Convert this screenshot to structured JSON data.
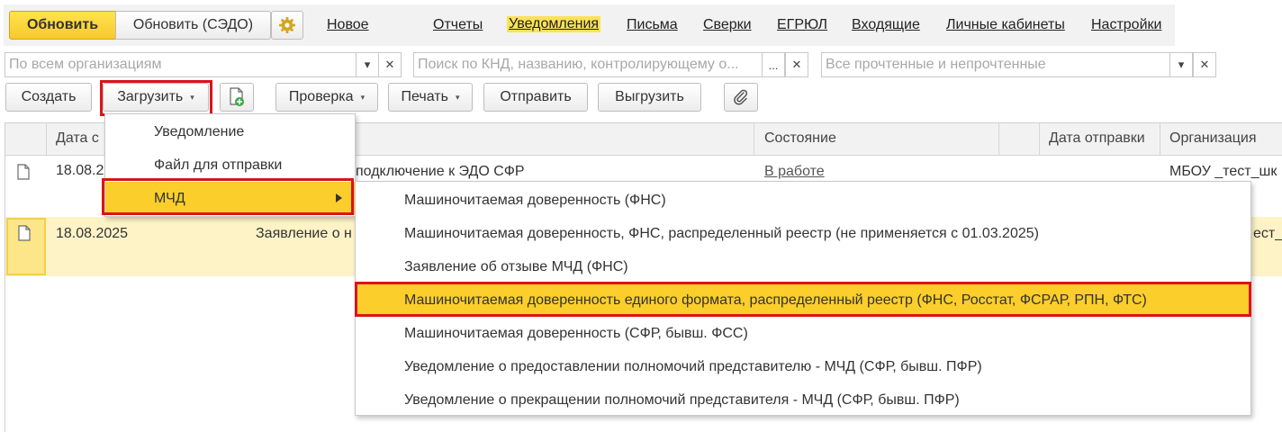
{
  "topbar": {
    "refresh_label": "Обновить",
    "refresh_sedo_label": "Обновить (СЭДО)",
    "settings_icon": "gear-icon",
    "nav": [
      {
        "label": "Новое",
        "active": false
      },
      {
        "label": "Отчеты",
        "active": false
      },
      {
        "label": "Уведомления",
        "active": true
      },
      {
        "label": "Письма",
        "active": false
      },
      {
        "label": "Сверки",
        "active": false
      },
      {
        "label": "ЕГРЮЛ",
        "active": false
      },
      {
        "label": "Входящие",
        "active": false
      },
      {
        "label": "Личные кабинеты",
        "active": false
      },
      {
        "label": "Настройки",
        "active": false
      }
    ]
  },
  "filters": {
    "org_placeholder": "По всем организациям",
    "search_placeholder": "Поиск по КНД, названию, контролирующему о...",
    "read_placeholder": "Все прочтенные и непрочтенные",
    "select_btn": "...",
    "dropdown_icon": "▾",
    "clear_icon": "✕"
  },
  "toolbar": {
    "create_label": "Создать",
    "upload_label": "Загрузить",
    "check_label": "Проверка",
    "print_label": "Печать",
    "send_label": "Отправить",
    "export_label": "Выгрузить",
    "caret": "▾"
  },
  "table": {
    "columns": {
      "date": "Дата с",
      "state": "Состояние",
      "sent_date": "Дата отправки",
      "org": "Организация"
    },
    "rows": [
      {
        "date": "18.08.2",
        "name": "подключение к ЭДО СФР",
        "state": "В работе",
        "org": "МБОУ _тест_шк"
      },
      {
        "date": "18.08.2025",
        "name": "Заявление о н",
        "state": "",
        "org": "ест_шк"
      }
    ]
  },
  "upload_menu": {
    "items": [
      {
        "label": "Уведомление",
        "selected": false,
        "submenu": false
      },
      {
        "label": "Файл для отправки",
        "selected": false,
        "submenu": false
      },
      {
        "label": "МЧД",
        "selected": true,
        "submenu": true
      }
    ]
  },
  "mchd_menu": {
    "items": [
      {
        "label": "Машиночитаемая доверенность (ФНС)",
        "selected": false
      },
      {
        "label": "Машиночитаемая доверенность, ФНС, распределенный реестр (не применяется с 01.03.2025)",
        "selected": false
      },
      {
        "label": "Заявление об отзыве МЧД (ФНС)",
        "selected": false
      },
      {
        "label": "Машиночитаемая доверенность единого формата, распределенный реестр (ФНС, Росстат, ФСРАР, РПН, ФТС)",
        "selected": true
      },
      {
        "label": "Машиночитаемая доверенность (СФР, бывш. ФСС)",
        "selected": false
      },
      {
        "label": "Уведомление о предоставлении полномочий представителю - МЧД (СФР, бывш. ПФР)",
        "selected": false
      },
      {
        "label": "Уведомление о прекращении полномочий представителя - МЧД (СФР, бывш. ПФР)",
        "selected": false
      }
    ]
  },
  "colors": {
    "accent_yellow": "#fbce2b",
    "highlight_red": "#d9141b",
    "selected_row": "#fdf3c6"
  }
}
